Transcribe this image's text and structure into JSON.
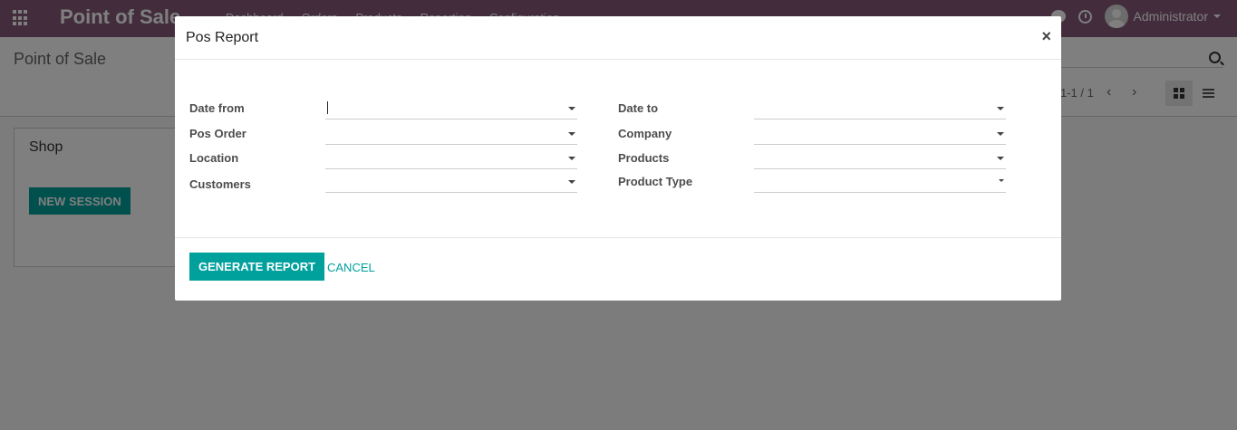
{
  "app": {
    "brand": "Point of Sale",
    "menu": [
      "Dashboard",
      "Orders",
      "Products",
      "Reporting",
      "Configuration"
    ],
    "user": "Administrator"
  },
  "control_panel": {
    "title": "Point of Sale",
    "pager": "1-1 / 1"
  },
  "shop_card": {
    "title": "Shop",
    "new_session_label": "NEW SESSION"
  },
  "modal": {
    "title": "Pos Report",
    "close": "×",
    "fields_left": [
      {
        "label": "Date from",
        "value": ""
      },
      {
        "label": "Pos Order",
        "value": ""
      },
      {
        "label": "Location",
        "value": ""
      },
      {
        "label": "Customers",
        "value": ""
      }
    ],
    "fields_right": [
      {
        "label": "Date to",
        "value": ""
      },
      {
        "label": "Company",
        "value": ""
      },
      {
        "label": "Products",
        "value": ""
      },
      {
        "label": "Product Type",
        "value": ""
      }
    ],
    "generate_label": "GENERATE REPORT",
    "cancel_label": "CANCEL"
  },
  "colors": {
    "navbar": "#875a7b",
    "accent": "#00a09d"
  }
}
